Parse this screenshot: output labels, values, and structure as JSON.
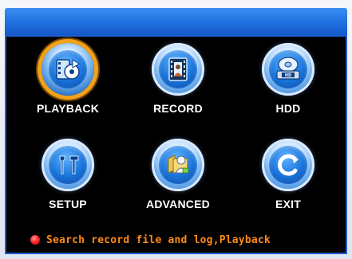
{
  "menu": {
    "items": [
      {
        "id": "playback",
        "label": "PLAYBACK",
        "icon": "playback-icon",
        "selected": true
      },
      {
        "id": "record",
        "label": "RECORD",
        "icon": "record-icon",
        "selected": false
      },
      {
        "id": "hdd",
        "label": "HDD",
        "icon": "hdd-icon",
        "selected": false
      },
      {
        "id": "setup",
        "label": "SETUP",
        "icon": "setup-icon",
        "selected": false
      },
      {
        "id": "advanced",
        "label": "ADVANCED",
        "icon": "advanced-icon",
        "selected": false
      },
      {
        "id": "exit",
        "label": "EXIT",
        "icon": "exit-icon",
        "selected": false
      }
    ]
  },
  "status": {
    "text": "Search record file and log,Playback",
    "indicator_color": "#ff2a2a",
    "text_color": "#ff8a1a"
  },
  "colors": {
    "topbar": "#1f6fe0",
    "screen_bg": "#000000",
    "selected_ring": "#f2a21a",
    "label": "#ffffff"
  }
}
